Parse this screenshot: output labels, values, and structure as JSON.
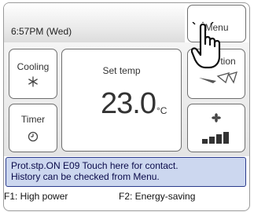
{
  "status": {
    "clock": "6:57PM (Wed)"
  },
  "menu": {
    "label": "Menu"
  },
  "mode": {
    "label": "Cooling",
    "icon": "snowflake-icon"
  },
  "timer": {
    "label": "Timer",
    "icon": "clock-icon"
  },
  "set_temp": {
    "label": "Set temp",
    "value": "23.0",
    "unit": "°C"
  },
  "air_direction": {
    "label": "tion",
    "icon": "louver-vane-icon"
  },
  "fan": {
    "icon": "fan-speed-icon",
    "level_bars": 4
  },
  "message": {
    "line1": "Prot.stp.ON E09 Touch here for contact.",
    "line2": "History can be checked from Menu."
  },
  "footer": {
    "f1": "F1: High power",
    "f2": "F2: Energy-saving"
  },
  "colors": {
    "message_bg": "#ccd7ef",
    "message_border": "#2a3a8c",
    "button_border": "#6e6e6e"
  }
}
